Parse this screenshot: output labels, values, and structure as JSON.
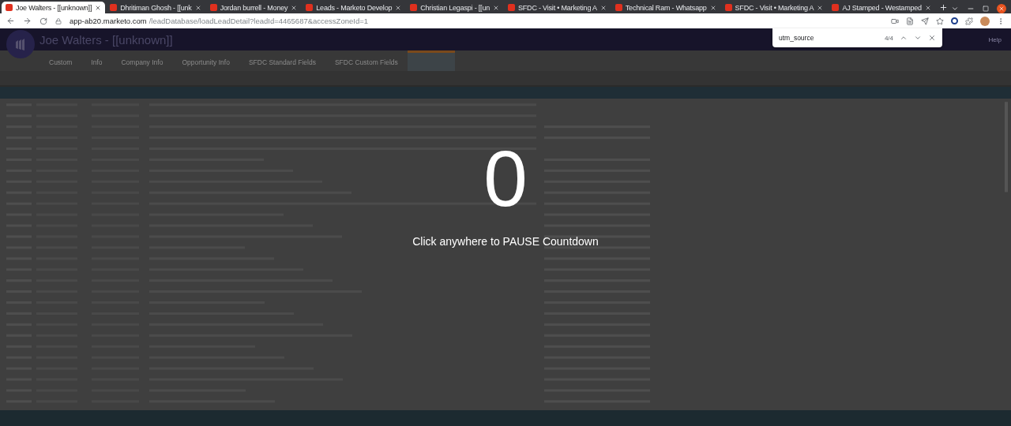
{
  "browser": {
    "tabs": [
      {
        "title": "Joe Walters - [[unknown]]",
        "selected": true
      },
      {
        "title": "Dhritiman Ghosh - [[unk",
        "selected": false
      },
      {
        "title": "Jordan burrell - Money",
        "selected": false
      },
      {
        "title": "Leads - Marketo Develop",
        "selected": false
      },
      {
        "title": "Christian Legaspi - [[un",
        "selected": false
      },
      {
        "title": "SFDC - Visit • Marketing A",
        "selected": false
      },
      {
        "title": "Technical Ram - Whatsapp",
        "selected": false
      },
      {
        "title": "SFDC - Visit • Marketing A",
        "selected": false
      },
      {
        "title": "AJ Stamped - Westamped",
        "selected": false
      }
    ],
    "url": {
      "host": "app-ab20.marketo.com",
      "path": "/leadDatabase/loadLeadDetail?leadId=4465687&accessZoneId=1"
    },
    "find_bar": {
      "query": "utm_source",
      "count": "4/4"
    }
  },
  "header": {
    "title": "Joe Walters - [[unknown]]",
    "links": [
      "Help"
    ]
  },
  "nav_tabs": [
    {
      "label": "Custom",
      "selected": false
    },
    {
      "label": "Info",
      "selected": false
    },
    {
      "label": "Company Info",
      "selected": false
    },
    {
      "label": "Opportunity Info",
      "selected": false
    },
    {
      "label": "SFDC Standard Fields",
      "selected": false
    },
    {
      "label": "SFDC Custom Fields",
      "selected": false
    }
  ],
  "overlay": {
    "count": "0",
    "message": "Click anywhere to PAUSE Countdown"
  }
}
